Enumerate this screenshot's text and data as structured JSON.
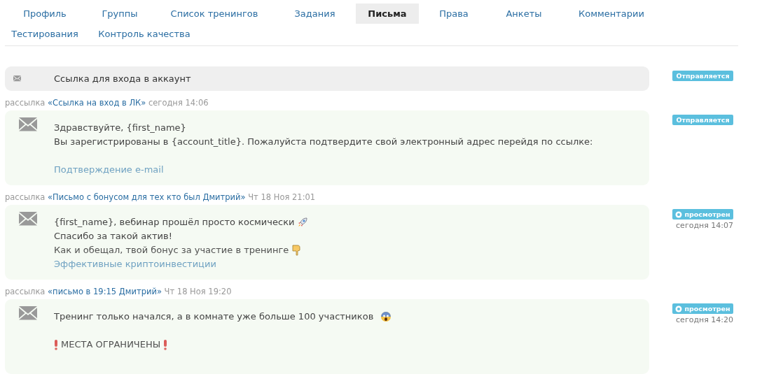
{
  "tabs": [
    {
      "label": "Профиль",
      "selected": false
    },
    {
      "label": "Группы",
      "selected": false
    },
    {
      "label": "Список тренингов",
      "selected": false
    },
    {
      "label": "Задания",
      "selected": false
    },
    {
      "label": "Письма",
      "selected": true
    },
    {
      "label": "Права",
      "selected": false
    },
    {
      "label": "Анкеты",
      "selected": false
    },
    {
      "label": "Комментарии",
      "selected": false
    },
    {
      "label": "Тестирования",
      "selected": false
    },
    {
      "label": "Контроль качества",
      "selected": false
    }
  ],
  "subject": {
    "title": "Ссылка для входа в аккаунт",
    "status": {
      "kind": "sending",
      "label": "Отправляется"
    }
  },
  "messages": [
    {
      "prefix": "рассылка",
      "campaign": "«Ссылка на вход в ЛК»",
      "date": "сегодня 14:06",
      "status": {
        "kind": "sending",
        "label": "Отправляется"
      },
      "lines": [
        {
          "kind": "text",
          "text": "Здравствуйте, {first_name}"
        },
        {
          "kind": "text",
          "text": "Вы зарегистрированы в {account_title}. Пожалуйста подтвердите свой электронный адрес перейдя по ссылке:"
        },
        {
          "kind": "gap"
        },
        {
          "kind": "link",
          "text": "Подтверждение e-mail"
        }
      ]
    },
    {
      "prefix": "рассылка",
      "campaign": "«Письмо с бонусом для тех кто был Дмитрий»",
      "date": "Чт 18 Ноя 21:01",
      "status": {
        "kind": "viewed",
        "label": "просмотрен",
        "time": "сегодня 14:07"
      },
      "lines": [
        {
          "kind": "text",
          "parts": [
            {
              "kind": "text",
              "text": "{first_name}, вебинар прошёл просто космически"
            },
            {
              "kind": "rocket"
            }
          ]
        },
        {
          "kind": "text",
          "text": "Спасибо за такой актив!"
        },
        {
          "kind": "text",
          "parts": [
            {
              "kind": "text",
              "text": "Как и обещал, твой бонус за участие в тренинге"
            },
            {
              "kind": "hand"
            }
          ]
        },
        {
          "kind": "link",
          "text": "Эффективные криптоинвестиции"
        }
      ]
    },
    {
      "prefix": "рассылка",
      "campaign": "«письмо в 19:15 Дмитрий»",
      "date": "Чт 18 Ноя 19:20",
      "status": {
        "kind": "viewed",
        "label": "просмотрен",
        "time": "сегодня 14:20"
      },
      "lines": [
        {
          "kind": "text",
          "parts": [
            {
              "kind": "text",
              "text": "Тренинг только начался, а в комнате уже больше 100 участников"
            },
            {
              "kind": "face"
            }
          ]
        },
        {
          "kind": "gap"
        },
        {
          "kind": "text",
          "parts": [
            {
              "kind": "exclamation"
            },
            {
              "kind": "text",
              "text": "МЕСТА ОГРАНИЧЕНЫ"
            },
            {
              "kind": "exclamation"
            }
          ]
        }
      ]
    }
  ]
}
